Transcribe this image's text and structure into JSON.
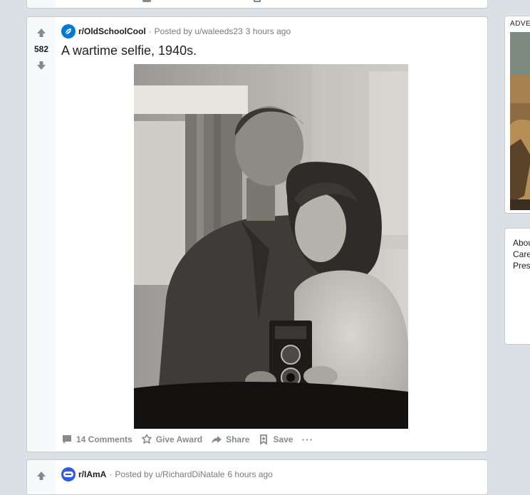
{
  "post_main": {
    "subreddit": "r/OldSchoolCool",
    "posted_by": "Posted by u/waleeds23",
    "time": "3 hours ago",
    "score": "582",
    "title": "A wartime selfie, 1940s.",
    "photo_description": "Black and white mirror selfie of a uniformed soldier and a woman holding a twin-lens camera",
    "actions": {
      "comments": "14 Comments",
      "award": "Give Award",
      "share": "Share",
      "save": "Save",
      "more": "···"
    }
  },
  "post_next": {
    "subreddit": "r/IAmA",
    "posted_by": "Posted by u/RichardDiNatale",
    "time": "6 hours ago"
  },
  "sidebar": {
    "ad_label": "ADVERTISEMENT",
    "links": [
      "About",
      "Careers",
      "Press"
    ]
  },
  "colors": {
    "background": "#dae0e6",
    "upvote_icon": "#878a8c",
    "oldschoolcool_icon": "#0079d3",
    "iama_icon": "#2e5bd8"
  }
}
